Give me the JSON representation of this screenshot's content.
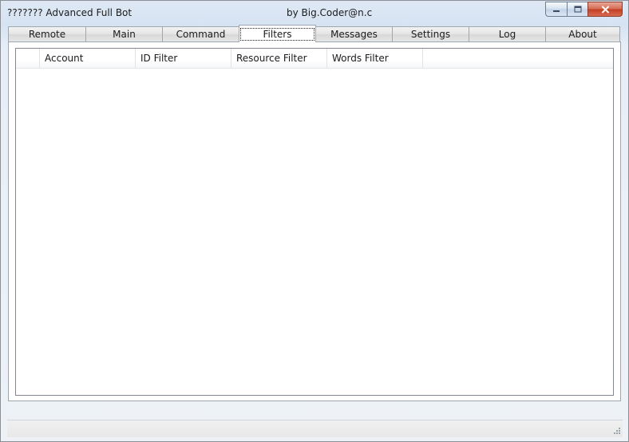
{
  "window": {
    "title": "??????? Advanced Full Bot",
    "subtitle": "by Big.Coder@n.c",
    "controls": {
      "minimize_icon": "minimize-icon",
      "maximize_icon": "maximize-icon",
      "close_icon": "close-icon"
    }
  },
  "tabs": [
    {
      "label": "Remote"
    },
    {
      "label": "Main"
    },
    {
      "label": "Command"
    },
    {
      "label": "Filters",
      "active": true
    },
    {
      "label": "Messages"
    },
    {
      "label": "Settings"
    },
    {
      "label": "Log"
    },
    {
      "label": "About"
    }
  ],
  "filters_list": {
    "columns": [
      "",
      "Account",
      "ID Filter",
      "Resource Filter",
      "Words Filter"
    ],
    "rows": []
  },
  "statusbar": {
    "grip_icon": "resize-grip-icon"
  }
}
